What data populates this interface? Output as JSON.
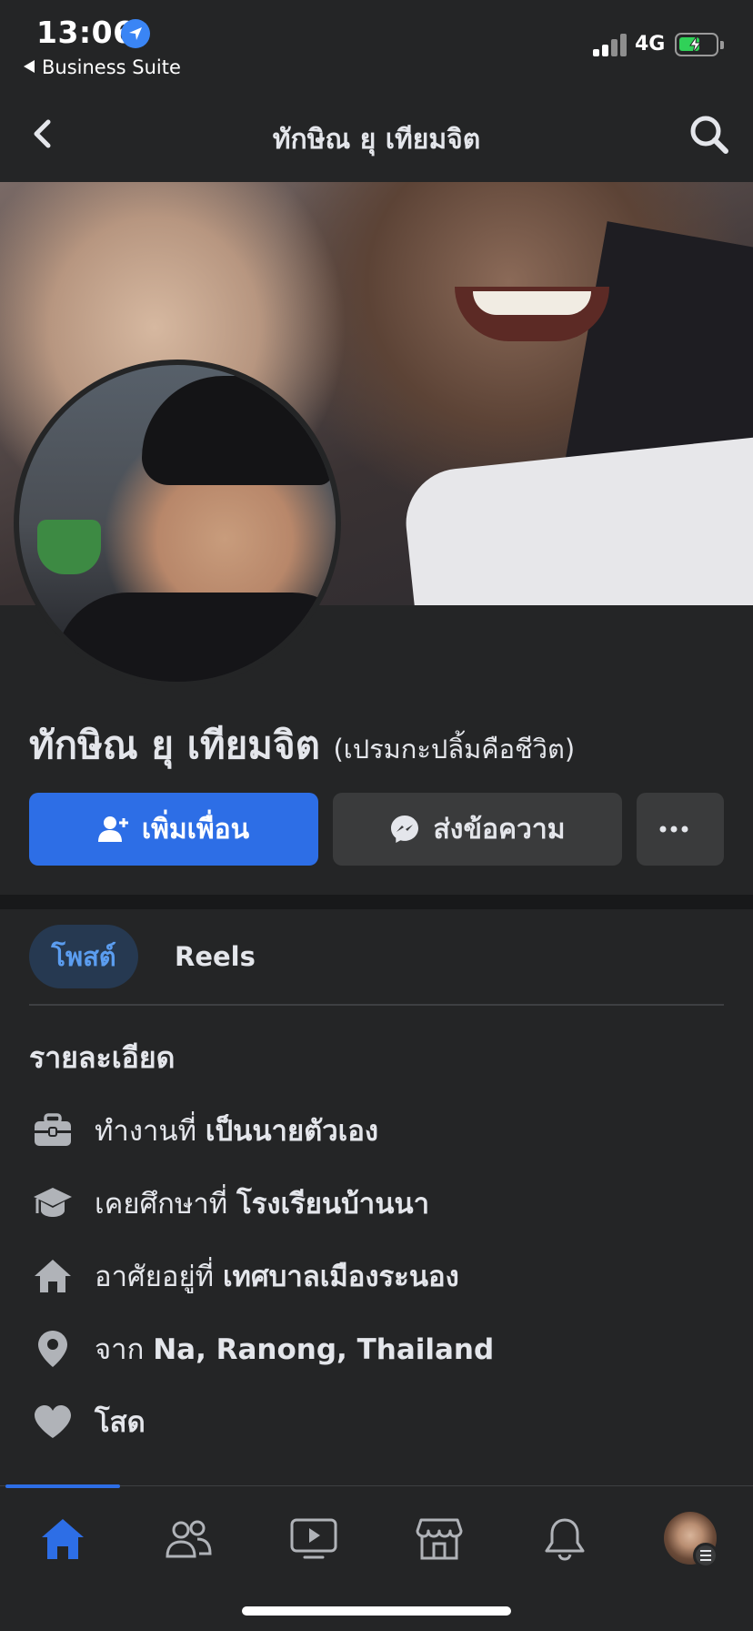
{
  "status_bar": {
    "time": "13:06",
    "back_app": "Business Suite",
    "network": "4G"
  },
  "nav": {
    "title": "ทักษิณ ยุ เทียมจิต"
  },
  "profile": {
    "name": "ทักษิณ ยุ เทียมจิต",
    "alt_name": "(เปรมกะปลิ้มคือชีวิต)"
  },
  "actions": {
    "add_friend": "เพิ่มเพื่อน",
    "message": "ส่งข้อความ",
    "more": "..."
  },
  "tabs": [
    {
      "label": "โพสต์"
    },
    {
      "label": "Reels"
    }
  ],
  "details": {
    "title": "รายละเอียด",
    "items": [
      {
        "icon": "briefcase-icon",
        "prefix": "ทำงานที่ ",
        "value": "เป็นนายตัวเอง"
      },
      {
        "icon": "graduation-cap-icon",
        "prefix": "เคยศึกษาที่ ",
        "value": "โรงเรียนบ้านนา"
      },
      {
        "icon": "home-icon",
        "prefix": "อาศัยอยู่ที่ ",
        "value": "เทศบาลเมืองระนอง"
      },
      {
        "icon": "location-pin-icon",
        "prefix": "จาก ",
        "value": "Na, Ranong, Thailand"
      },
      {
        "icon": "heart-icon",
        "prefix": "",
        "value": "โสด"
      }
    ]
  },
  "bottom_tabs": [
    {
      "icon": "home-icon"
    },
    {
      "icon": "friends-icon"
    },
    {
      "icon": "video-icon"
    },
    {
      "icon": "marketplace-icon"
    },
    {
      "icon": "bell-icon"
    },
    {
      "icon": "profile-menu-avatar"
    }
  ],
  "colors": {
    "background": "#242526",
    "accent": "#2d6ee6",
    "tab_active_bg": "#263951",
    "tab_active_text": "#5b9df0"
  }
}
